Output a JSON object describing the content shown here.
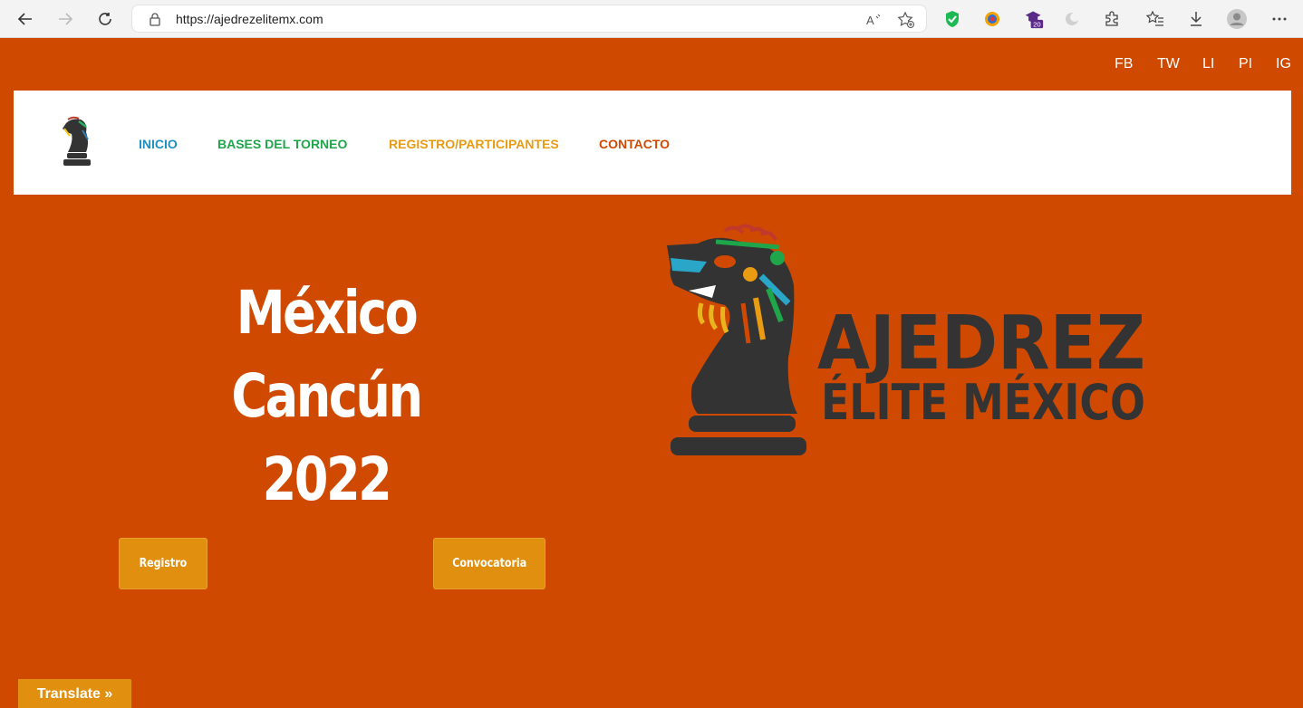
{
  "browser": {
    "url": "https://ajedrezelitemx.com",
    "extension_badge": "20"
  },
  "social": [
    "FB",
    "TW",
    "LI",
    "PI",
    "IG"
  ],
  "nav": {
    "links": [
      {
        "label": "INICIO",
        "color": "#1e8fbf"
      },
      {
        "label": "BASES DEL TORNEO",
        "color": "#1fa64a"
      },
      {
        "label": "REGISTRO/PARTICIPANTES",
        "color": "#e89b13"
      },
      {
        "label": "CONTACTO",
        "color": "#d14900"
      }
    ]
  },
  "hero": {
    "title_line1": "México Cancún",
    "title_line2": "2022"
  },
  "brand": {
    "word1": "AJEDREZ",
    "word2": "ÉLITE MÉXICO"
  },
  "buttons": {
    "registro": "Registro",
    "convocatoria": "Convocatoria"
  },
  "translate_label": "Translate »",
  "colors": {
    "page_bg": "#cf4a00",
    "button_bg": "#e0900e",
    "logo_dark": "#333333"
  }
}
